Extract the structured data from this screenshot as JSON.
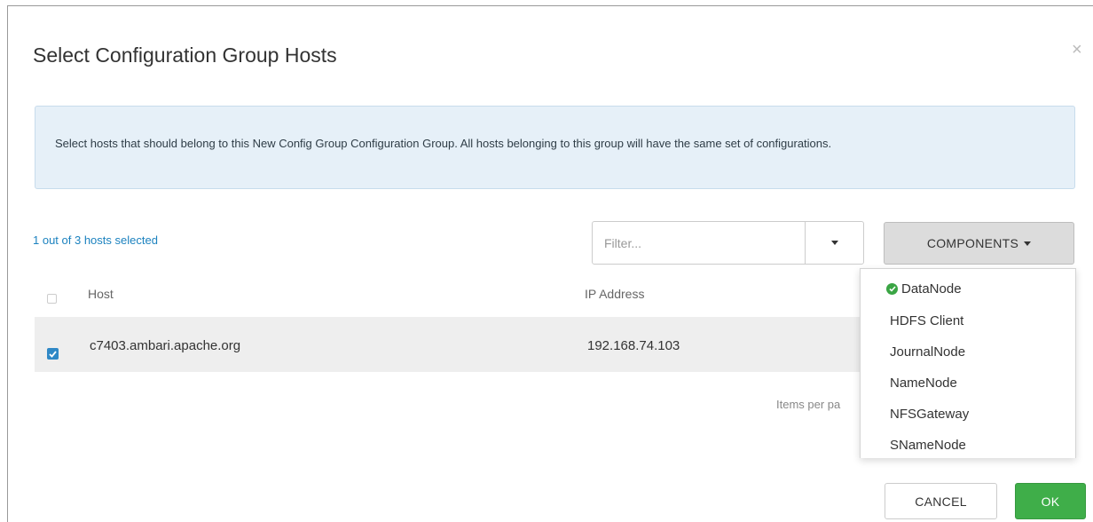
{
  "modal": {
    "title": "Select Configuration Group Hosts",
    "close_icon": "close-icon",
    "info_text": "Select hosts that should belong to this New Config Group Configuration Group. All hosts belonging to this group will have the same set of configurations."
  },
  "selection": {
    "summary": "1 out of 3 hosts selected"
  },
  "filter": {
    "placeholder": "Filter..."
  },
  "components_button": {
    "label": "COMPONENTS"
  },
  "table": {
    "headers": {
      "host": "Host",
      "ip": "IP Address"
    },
    "rows": [
      {
        "host": "c7403.ambari.apache.org",
        "ip": "192.168.74.103",
        "checked": true
      }
    ]
  },
  "pagination": {
    "items_per_page_label": "Items per pa"
  },
  "components_menu": {
    "items": [
      {
        "label": "DataNode",
        "selected": true
      },
      {
        "label": "HDFS Client",
        "selected": false
      },
      {
        "label": "JournalNode",
        "selected": false
      },
      {
        "label": "NameNode",
        "selected": false
      },
      {
        "label": "NFSGateway",
        "selected": false
      },
      {
        "label": "SNameNode",
        "selected": false
      }
    ]
  },
  "footer": {
    "cancel_label": "CANCEL",
    "ok_label": "OK"
  },
  "colors": {
    "link": "#1c82bf",
    "ok_button": "#3fae49",
    "info_bg": "#e6f0f8",
    "checkbox": "#2f88c6",
    "check_green": "#3aa544"
  }
}
